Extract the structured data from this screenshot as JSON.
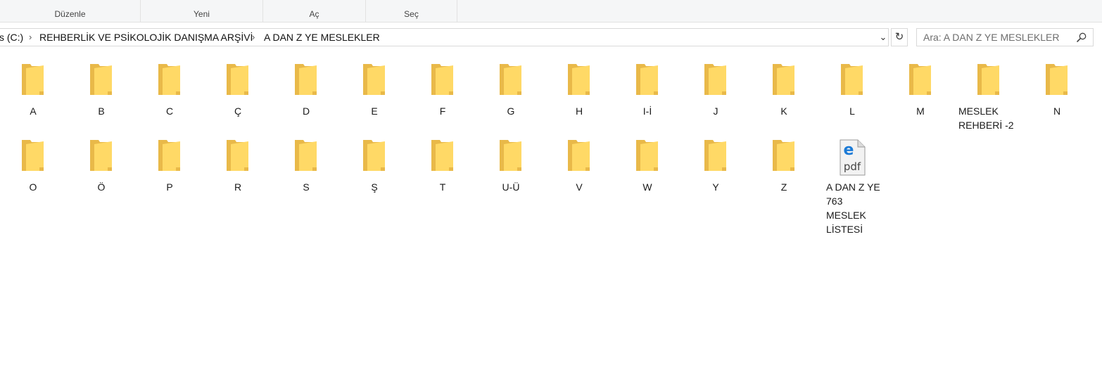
{
  "ribbon": {
    "groups": [
      {
        "label": "Düzenle"
      },
      {
        "label": "Yeni"
      },
      {
        "label": "Aç"
      },
      {
        "label": "Seç"
      }
    ]
  },
  "address": {
    "crumbs": [
      "s (C:)",
      "REHBERLİK VE PSİKOLOJİK DANIŞMA ARŞİVİ",
      "A DAN Z YE MESLEKLER"
    ],
    "separator": "›",
    "dropdown_glyph": "⌄",
    "refresh_glyph": "↻"
  },
  "search": {
    "placeholder": "Ara: A DAN Z YE MESLEKLER",
    "value": ""
  },
  "items_row1": [
    "A",
    "B",
    "C",
    "Ç",
    "D",
    "E",
    "F",
    "G",
    "H",
    "I-İ",
    "J",
    "K",
    "L",
    "M",
    "MESLEK REHBERİ -2",
    "N"
  ],
  "items_row2": [
    "O",
    "Ö",
    "P",
    "R",
    "S",
    "Ş",
    "T",
    "U-Ü",
    "V",
    "W",
    "Y",
    "Z"
  ],
  "pdf_file": {
    "name": "A DAN Z YE 763 MESLEK LİSTESİ",
    "icon_text": "pdf",
    "badge_letter": "e"
  },
  "colors": {
    "folder_back": "#e9b949",
    "folder_front": "#ffd966",
    "edge_blue": "#1b7ad6"
  }
}
